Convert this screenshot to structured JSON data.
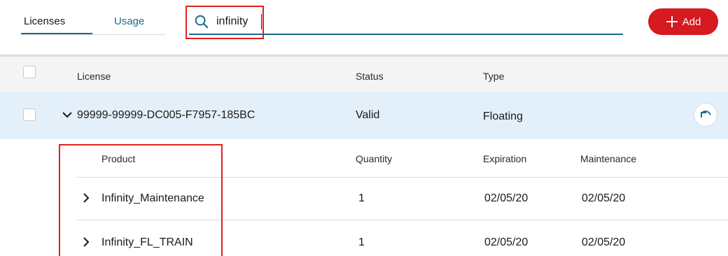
{
  "tabs": [
    {
      "label": "Licenses",
      "active": true
    },
    {
      "label": "Usage",
      "active": false
    }
  ],
  "search": {
    "value": "infinity",
    "placeholder": ""
  },
  "add_button": {
    "label": "Add"
  },
  "table": {
    "headers": {
      "license": "License",
      "status": "Status",
      "type": "Type"
    },
    "license_row": {
      "license": "99999-99999-DC005-F7957-185BC",
      "status": "Valid",
      "type": "Floating",
      "expanded": true
    },
    "products": {
      "headers": {
        "product": "Product",
        "quantity": "Quantity",
        "expiration": "Expiration",
        "maintenance": "Maintenance"
      },
      "rows": [
        {
          "product": "Infinity_Maintenance",
          "quantity": "1",
          "expiration": "02/05/20",
          "maintenance": "02/05/20"
        },
        {
          "product": "Infinity_FL_TRAIN",
          "quantity": "1",
          "expiration": "02/05/20",
          "maintenance": "02/05/20"
        }
      ]
    }
  },
  "colors": {
    "accent": "#1b6b8f",
    "add_button": "#d71920",
    "selected_row": "#e3f0fa",
    "highlight": "#e02020"
  },
  "icons": {
    "search": "search-icon",
    "add": "plus-icon",
    "expand": "chevron-down-icon",
    "row_expand": "chevron-right-icon",
    "undo": "undo-icon"
  }
}
